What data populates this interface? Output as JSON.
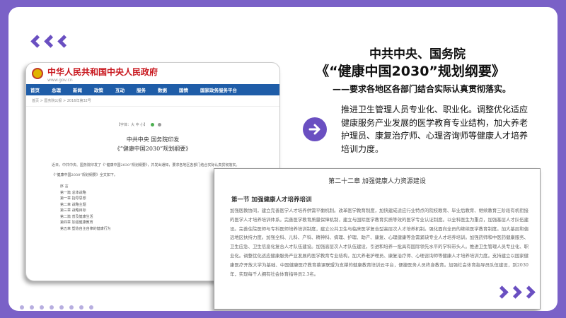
{
  "slide": {
    "title_line1": "中共中央、国务院",
    "title_line2": "《“健康中国2030”规划纲要》",
    "subtitle": "——要求各地区各部门结合实际认真贯彻落实。",
    "body": "推进卫生管理人员专业化、职业化。调整优化适应健康服务产业发展的医学教育专业结构，加大养老护理员、康复治疗师、心理咨询师等健康人才培养培训力度。"
  },
  "doc_left": {
    "site_title": "中华人民共和国中央人民政府",
    "site_url": "www.gov.cn",
    "nav": [
      "首页",
      "总理",
      "新闻",
      "政策",
      "互动",
      "服务",
      "数据",
      "国情",
      "国家政务服务平台"
    ],
    "breadcrumb": "首页 > 国务院公报 > 2016年第32号",
    "tools": "【字体：大 中 小】",
    "heading1": "中共中央 国务院印发",
    "heading2": "《“健康中国2030”规划纲要》",
    "intro": "近日，中共中央、国务院印发了《“健康中国2030”规划纲要》，并发出通知，要求各地区各部门结合实际认真贯彻落实。",
    "intro2": "《“健康中国2030”规划纲要》全文如下。",
    "toc": [
      "序  言",
      "第一篇  总体战略",
      "第一章  指导思想",
      "第二章  战略主题",
      "第三章  战略目标",
      "第二篇  普及健康生活",
      "第四章  加强健康教育",
      "第五章  塑造自主自律的健康行为"
    ]
  },
  "doc_right": {
    "chapter": "第二十二章  加强健康人力资源建设",
    "section": "第一节  加强健康人才培养培训",
    "paragraph": "加强医教协同，建立完善医学人才培养供需平衡机制。改革医学教育制度，加快建成适应行业特点的院校教育、毕业后教育、继续教育三阶段有机衔接的医学人才培养培训体系。完善医学教育质量保障机制，建立与国际医学教育实质等效的医学专业认证制度。以全科医生为重点，加强基层人才队伍建设。完善住院医师与专科医师培养培训制度，建立公共卫生与临床医学复合型高层次人才培养机制。强化面向全员的继续医学教育制度。加大基层和偏远地区扶持力度。加强全科、儿科、产科、精神科、病理、护理、助产、康复、心理健康等急需紧缺专业人才培养培训。加强药师和中医药健康服务、卫生应急、卫生信息化复合人才队伍建设。加强高层次人才队伍建设，引进和培养一批具有国际领先水平的学科带头人。推进卫生管理人员专业化、职业化。调整优化适应健康服务产业发展的医学教育专业结构，加大养老护理员、康复治疗师、心理咨询师等健康人才培养培训力度。支持建立以国家健康医疗开放大学为基础、中国健康医疗教育慕课联盟为支撑的健康教育培训云平台，便捷医务人员终身教育。加强社会体育指导员队伍建设，到2030年，实现每千人拥有社会体育指导员2.3名。"
  },
  "colors": {
    "accent": "#6a4fc1",
    "background": "#7a61c7",
    "gov_red": "#c8161d",
    "gov_nav": "#1f5da8"
  },
  "icons": {
    "arrow": "arrow-right-icon",
    "chevrons": "chevron-left-icon",
    "emblem": "national-emblem-icon"
  }
}
